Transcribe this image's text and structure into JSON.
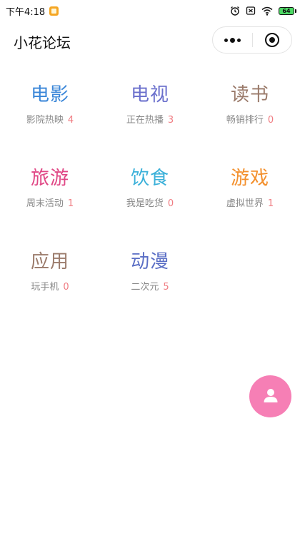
{
  "status_bar": {
    "time": "下午4:18",
    "battery_text": "64"
  },
  "nav": {
    "title": "小花论坛"
  },
  "categories": [
    {
      "title": "电影",
      "subtitle": "影院热映",
      "count": "4",
      "color": "#3a86d8"
    },
    {
      "title": "电视",
      "subtitle": "正在热播",
      "count": "3",
      "color": "#6a6fcc"
    },
    {
      "title": "读书",
      "subtitle": "畅销排行",
      "count": "0",
      "color": "#9a7a6a"
    },
    {
      "title": "旅游",
      "subtitle": "周末活动",
      "count": "1",
      "color": "#e04785"
    },
    {
      "title": "饮食",
      "subtitle": "我是吃货",
      "count": "0",
      "color": "#3ab0d9"
    },
    {
      "title": "游戏",
      "subtitle": "虚拟世界",
      "count": "1",
      "color": "#f3902d"
    },
    {
      "title": "应用",
      "subtitle": "玩手机",
      "count": "0",
      "color": "#9a7a6a"
    },
    {
      "title": "动漫",
      "subtitle": "二次元",
      "count": "5",
      "color": "#5a6ec5"
    }
  ],
  "colors": {
    "count": "#f07c82",
    "fab": "#f67fb5"
  },
  "icons": {
    "fab": "user-icon",
    "capsule_menu": "more-dots-icon",
    "capsule_close": "target-circle-icon"
  }
}
